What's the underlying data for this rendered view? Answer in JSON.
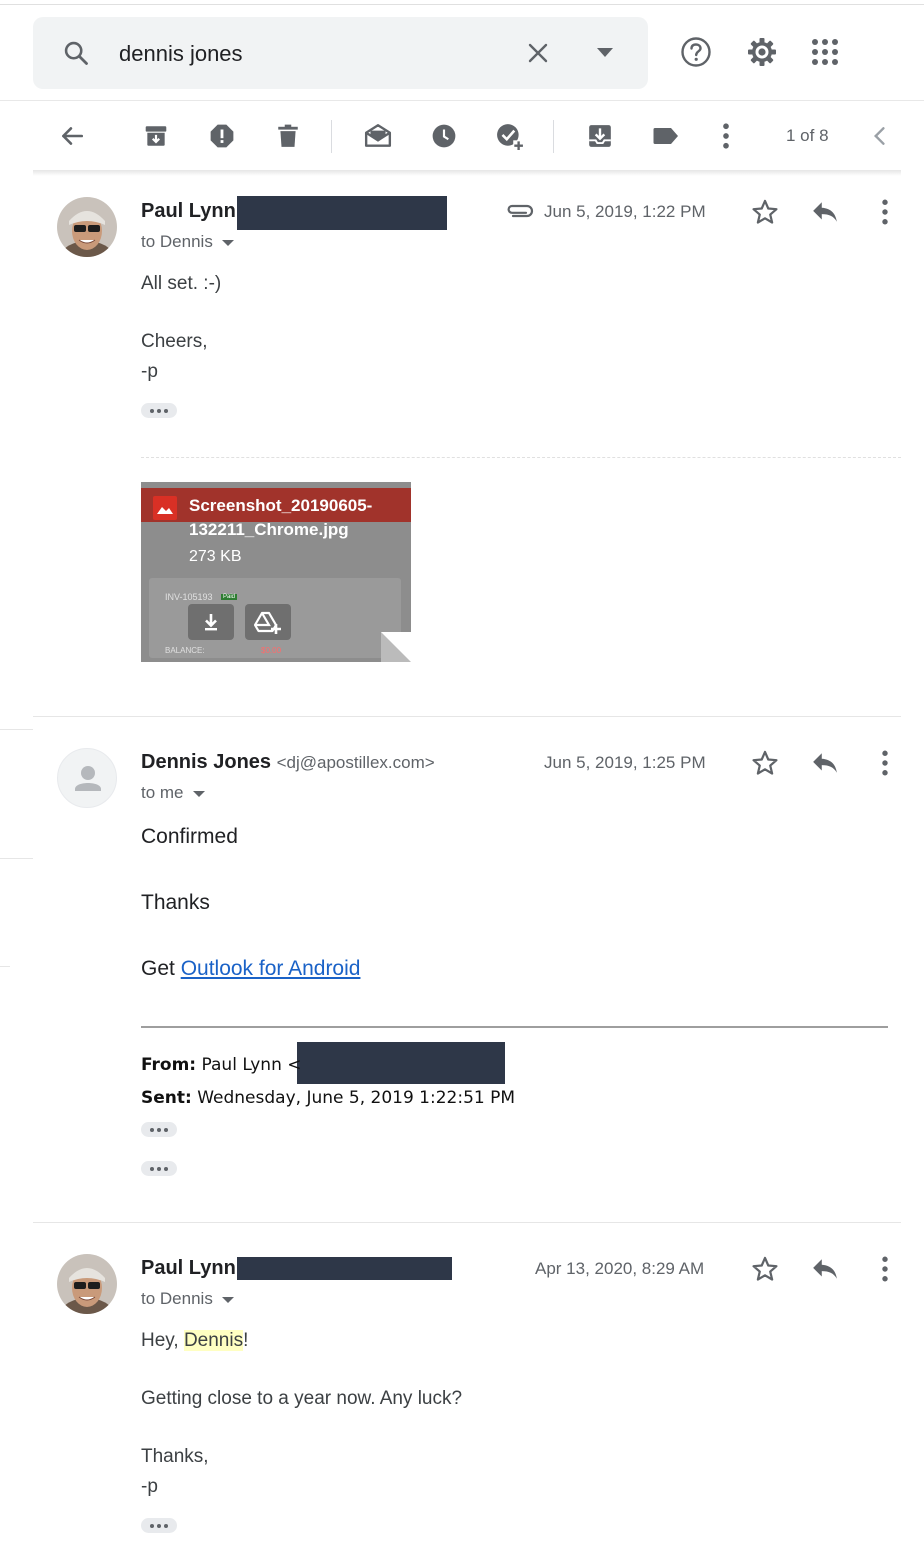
{
  "search": {
    "query": "dennis jones"
  },
  "toolbar": {
    "pager": "1 of 8"
  },
  "messages": [
    {
      "sender": "Paul Lynn",
      "to": "to Dennis",
      "date": "Jun 5, 2019, 1:22 PM",
      "body": [
        "All set. :-)",
        "Cheers,",
        "-p"
      ],
      "attachment": {
        "name": "Screenshot_20190605-132211_Chrome.jpg",
        "size": "273 KB",
        "preview_invoice": "INV-105193",
        "preview_status": "Paid",
        "preview_balance_label": "BALANCE:",
        "preview_balance": "$0.00"
      }
    },
    {
      "sender": "Dennis Jones",
      "email": "<dj@apostillex.com>",
      "to": "to me",
      "date": "Jun 5, 2019, 1:25 PM",
      "body": [
        "Confirmed",
        "Thanks"
      ],
      "get_prefix": "Get ",
      "link": "Outlook for Android",
      "quoted_from_label": "From:",
      "quoted_from_value": "Paul Lynn <",
      "quoted_sent_label": "Sent:",
      "quoted_sent_value": "Wednesday, June 5, 2019 1:22:51 PM"
    },
    {
      "sender": "Paul Lynn",
      "to": "to Dennis",
      "date": "Apr 13, 2020, 8:29 AM",
      "greeting_prefix": "Hey, ",
      "greeting_name": "Dennis",
      "greeting_suffix": "!",
      "body": [
        "Getting close to a year now. Any luck?",
        "Thanks,",
        "-p"
      ]
    }
  ],
  "colors": {
    "redaction": "#2e3748",
    "link": "#1a62c7",
    "highlight": "#ffffc2"
  }
}
